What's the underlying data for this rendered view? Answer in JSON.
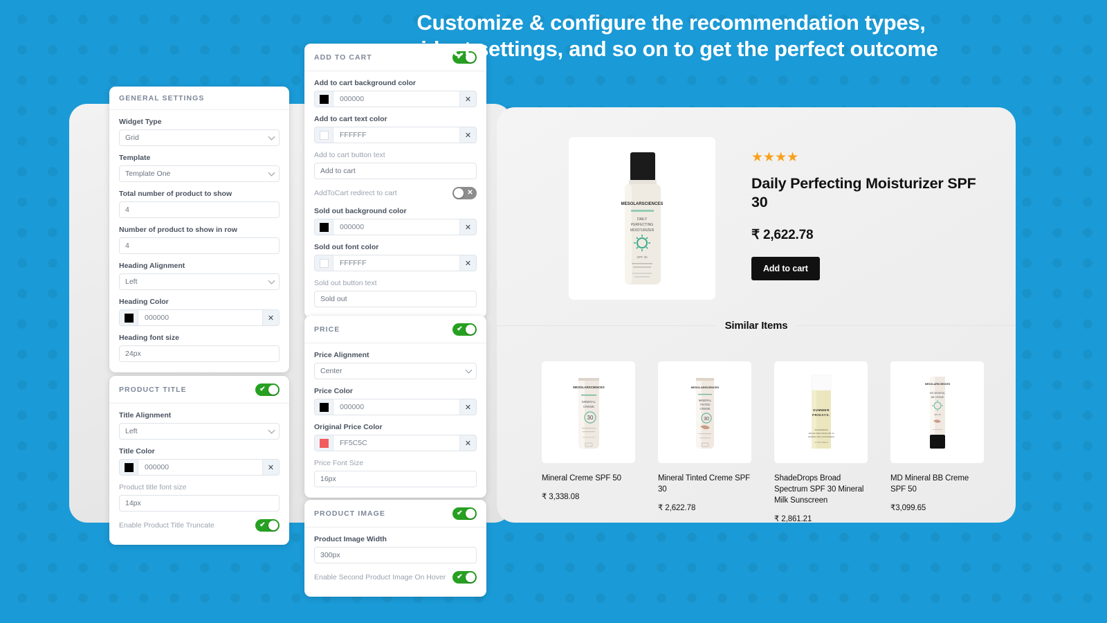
{
  "headline": "Customize & configure the recommendation types, widget settings, and so on to get the perfect outcome",
  "colors": {
    "background": "#1a9ad6",
    "toggle_on": "#27a021",
    "toggle_off": "#8d8d8d",
    "star": "#f9a11b",
    "button": "#111111"
  },
  "panels": {
    "general_settings": {
      "title": "GENERAL SETTINGS",
      "fields": {
        "widget_type_label": "Widget Type",
        "widget_type_value": "Grid",
        "template_label": "Template",
        "template_value": "Template One",
        "total_products_label": "Total number of product to show",
        "total_products_value": "4",
        "products_in_row_label": "Number of product to show in row",
        "products_in_row_value": "4",
        "heading_alignment_label": "Heading Alignment",
        "heading_alignment_value": "Left",
        "heading_color_label": "Heading Color",
        "heading_color_value": "000000",
        "heading_color_swatch": "#000000",
        "heading_font_size_label": "Heading font size",
        "heading_font_size_value": "24px"
      }
    },
    "product_title": {
      "title": "PRODUCT TITLE",
      "toggle": "on",
      "fields": {
        "title_alignment_label": "Title Alignment",
        "title_alignment_value": "Left",
        "title_color_label": "Title Color",
        "title_color_value": "000000",
        "title_color_swatch": "#000000",
        "title_font_size_label": "Product title font size",
        "title_font_size_value": "14px",
        "truncate_label": "Enable Product Title Truncate",
        "truncate_toggle": "on"
      }
    },
    "add_to_cart": {
      "title": "ADD TO CART",
      "toggle": "on",
      "fields": {
        "bg_color_label": "Add to cart background color",
        "bg_color_value": "000000",
        "bg_color_swatch": "#000000",
        "text_color_label": "Add to cart text color",
        "text_color_value": "FFFFFF",
        "text_color_swatch": "#ffffff",
        "button_text_label": "Add to cart button text",
        "button_text_value": "Add to cart",
        "redirect_label": "AddToCart redirect to cart",
        "redirect_toggle": "off",
        "soldout_bg_label": "Sold out background color",
        "soldout_bg_value": "000000",
        "soldout_bg_swatch": "#000000",
        "soldout_font_label": "Sold out font color",
        "soldout_font_value": "FFFFFF",
        "soldout_font_swatch": "#ffffff",
        "soldout_text_label": "Sold out button text",
        "soldout_text_value": "Sold out"
      }
    },
    "price": {
      "title": "PRICE",
      "toggle": "on",
      "fields": {
        "alignment_label": "Price Alignment",
        "alignment_value": "Center",
        "color_label": "Price Color",
        "color_value": "000000",
        "color_swatch": "#000000",
        "original_color_label": "Original Price Color",
        "original_color_value": "FF5C5C",
        "original_color_swatch": "#f25c5c",
        "font_size_label": "Price Font Size",
        "font_size_value": "16px"
      }
    },
    "product_image": {
      "title": "PRODUCT IMAGE",
      "toggle": "on",
      "fields": {
        "width_label": "Product Image Width",
        "width_value": "300px",
        "second_image_label": "Enable Second Product Image On Hover",
        "second_image_toggle": "on"
      }
    }
  },
  "preview": {
    "hero": {
      "stars": "★★★★",
      "title": "Daily Perfecting Moisturizer SPF 30",
      "price": "₹ 2,622.78",
      "add_to_cart_label": "Add to cart",
      "brand": "MESOLAR SCIENCES"
    },
    "similar_heading": "Similar Items",
    "similar_items": [
      {
        "name": "Mineral Creme SPF 50",
        "price": "₹ 3,338.08"
      },
      {
        "name": "Mineral Tinted Creme SPF 30",
        "price": "₹ 2,622.78"
      },
      {
        "name": "ShadeDrops Broad Spectrum SPF 30 Mineral Milk Sunscreen",
        "price": "₹ 2,861.21"
      },
      {
        "name": "MD Mineral BB Creme SPF 50",
        "price": "₹3,099.65"
      }
    ]
  },
  "icons": {
    "clear": "✕",
    "toggle_check": "✔",
    "toggle_cross": "✕"
  }
}
